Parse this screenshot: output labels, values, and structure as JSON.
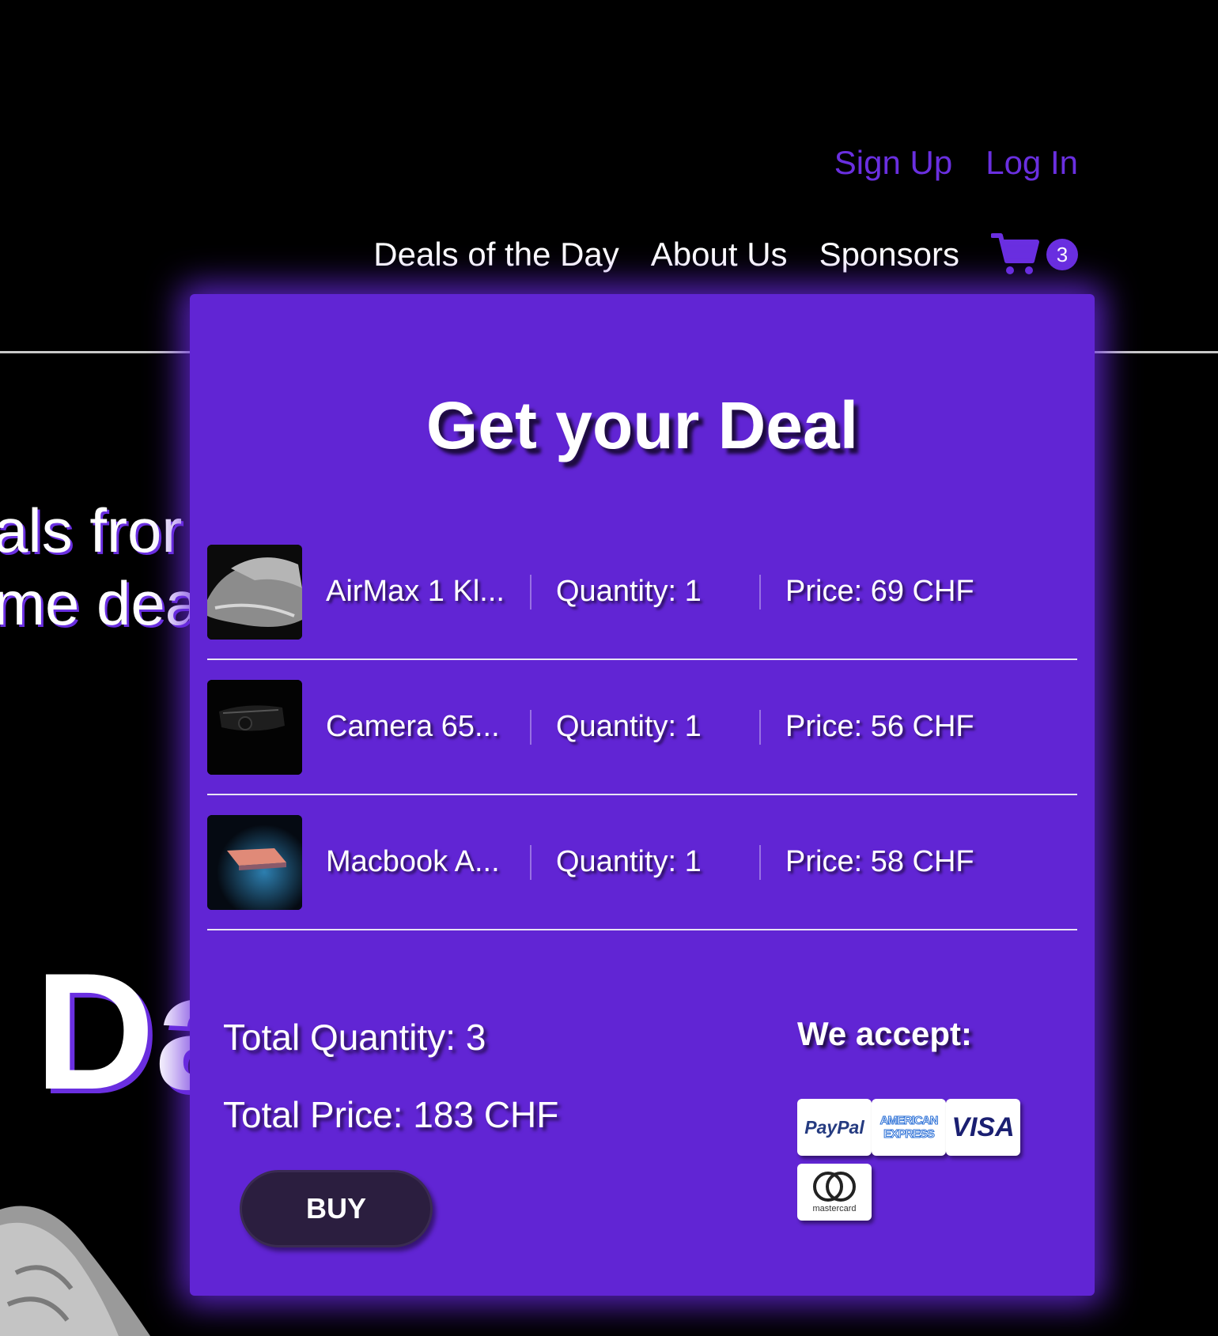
{
  "header": {
    "sign_up": "Sign Up",
    "log_in": "Log In",
    "nav": [
      "Deals of the Day",
      "About Us",
      "Sponsors"
    ],
    "cart_count": "3",
    "accent_color": "#6a2fe0"
  },
  "hero": {
    "line1": "als fror",
    "line2": "me dea",
    "big": "Da"
  },
  "cart_panel": {
    "title": "Get your Deal",
    "background_color": "#6125d4",
    "items": [
      {
        "name": "AirMax 1 Kl...",
        "quantity": "Quantity: 1",
        "price": "Price: 69 CHF",
        "icon": "sneaker-image"
      },
      {
        "name": "Camera 65...",
        "quantity": "Quantity: 1",
        "price": "Price: 56 CHF",
        "icon": "camera-image"
      },
      {
        "name": "Macbook A...",
        "quantity": "Quantity: 1",
        "price": "Price: 58 CHF",
        "icon": "laptop-image"
      }
    ],
    "total_quantity": "Total Quantity: 3",
    "total_price": "Total Price: 183 CHF",
    "buy_label": "BUY",
    "accept_title": "We accept:",
    "payment_methods": {
      "paypal": "PayPal",
      "amex_line1": "AMERICAN",
      "amex_line2": "EXPRESS",
      "visa": "VISA",
      "mastercard": "mastercard"
    }
  }
}
